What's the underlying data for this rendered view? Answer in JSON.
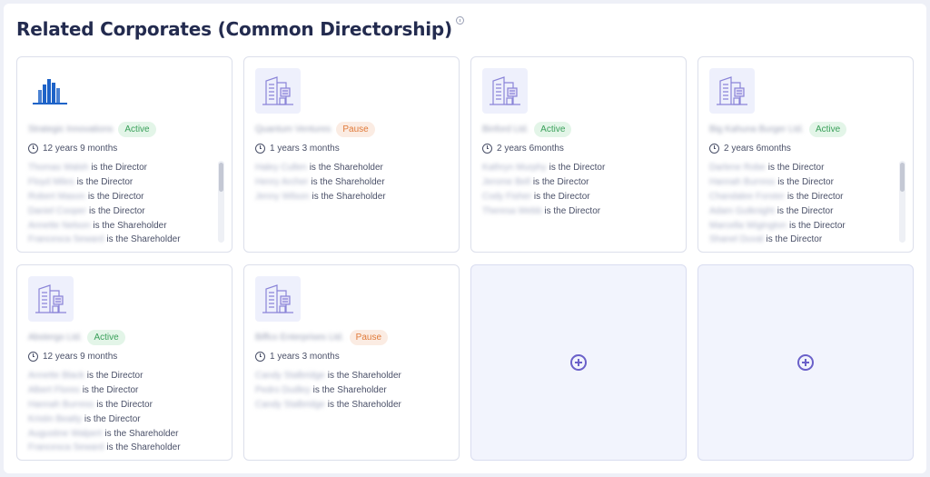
{
  "header": {
    "title": "Related Corporates (Common Directorship)"
  },
  "colors": {
    "active": "#3aa05a",
    "pause": "#e07a3a",
    "accent": "#6a60c9"
  },
  "cards": [
    {
      "logo": "blue-building-logo",
      "name": "Strategic Innovations",
      "status": "Active",
      "status_type": "active",
      "tenure": "12 years 9 months",
      "has_scrollbar": true,
      "roles": [
        {
          "person": "Thomas Walsh",
          "role": "is the Director"
        },
        {
          "person": "Floyd Miles",
          "role": "is the Director"
        },
        {
          "person": "Robert Mason",
          "role": "is the Director"
        },
        {
          "person": "Daniel Cooper",
          "role": "is the Director"
        },
        {
          "person": "Annette Nelson",
          "role": "is the Shareholder"
        },
        {
          "person": "Francesca Seward",
          "role": "is the Shareholder"
        }
      ]
    },
    {
      "logo": "building-icon",
      "name": "Quantum Ventures",
      "status": "Pause",
      "status_type": "pause",
      "tenure": "1 years 3 months",
      "has_scrollbar": false,
      "roles": [
        {
          "person": "Haley Cullen",
          "role": "is the Shareholder"
        },
        {
          "person": "Henry Archer",
          "role": "is the Shareholder"
        },
        {
          "person": "Jenny Wilson",
          "role": "is the Shareholder"
        }
      ]
    },
    {
      "logo": "building-icon",
      "name": "Binford Ltd.",
      "status": "Active",
      "status_type": "active",
      "tenure": "2 years 6months",
      "has_scrollbar": false,
      "roles": [
        {
          "person": "Kathryn Murphy",
          "role": "is the Director"
        },
        {
          "person": "Jerome Bell",
          "role": "is the Director"
        },
        {
          "person": "Cody Fisher",
          "role": "is the Director"
        },
        {
          "person": "Theresa Webb",
          "role": "is the Director"
        }
      ]
    },
    {
      "logo": "building-icon",
      "name": "Big Kahuna Burger Ltd.",
      "status": "Active",
      "status_type": "active",
      "tenure": "2 years 6months",
      "has_scrollbar": true,
      "roles": [
        {
          "person": "Darlene Robe",
          "role": "is the Director"
        },
        {
          "person": "Hannah Burress",
          "role": "is the Director"
        },
        {
          "person": "Chandalee Forster",
          "role": "is the Director"
        },
        {
          "person": "Adam Gutknight",
          "role": "is the Director"
        },
        {
          "person": "Marcella Wigington",
          "role": "is the Director"
        },
        {
          "person": "Shanel Duval",
          "role": "is the Director"
        }
      ]
    },
    {
      "logo": "building-icon",
      "name": "Abstergo Ltd.",
      "status": "Active",
      "status_type": "active",
      "tenure": "12 years 9 months",
      "has_scrollbar": false,
      "roles": [
        {
          "person": "Annette Black",
          "role": "is the Director"
        },
        {
          "person": "Albert Flores",
          "role": "is the Director"
        },
        {
          "person": "Hannah Burress",
          "role": "is the Director"
        },
        {
          "person": "Kristin Beatty",
          "role": "is the Director"
        },
        {
          "person": "Augustine Walpert",
          "role": "is the Shareholder"
        },
        {
          "person": "Francesca Seward",
          "role": "is the Shareholder"
        }
      ]
    },
    {
      "logo": "building-icon",
      "name": "Biffco Enterprises Ltd.",
      "status": "Pause",
      "status_type": "pause",
      "tenure": "1 years 3 months",
      "has_scrollbar": false,
      "roles": [
        {
          "person": "Candy Stalbridge",
          "role": "is the Shareholder"
        },
        {
          "person": "Pedro Dudley",
          "role": "is the Shareholder"
        },
        {
          "person": "Candy Stalbridge",
          "role": "is the Shareholder"
        }
      ]
    }
  ],
  "add_cards": [
    {
      "icon": "add-circle-icon"
    },
    {
      "icon": "add-circle-icon"
    }
  ]
}
